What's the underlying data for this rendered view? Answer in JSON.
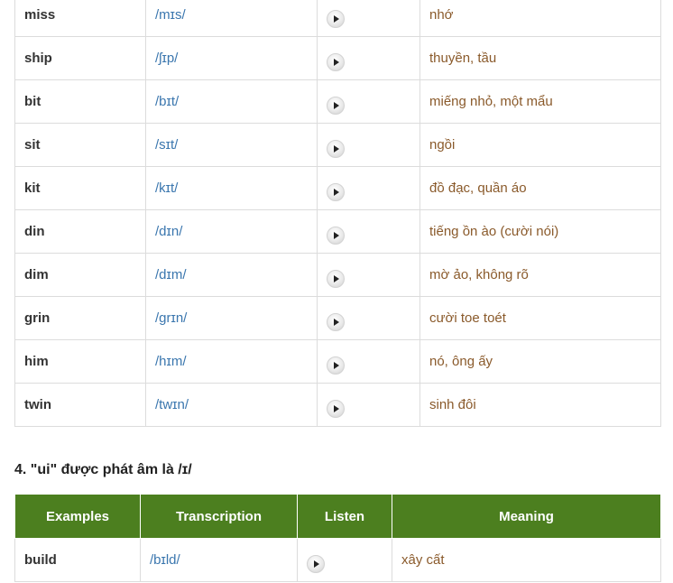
{
  "table1": {
    "rows": [
      {
        "word": "miss",
        "ipa": "/mɪs/",
        "meaning": "nhớ"
      },
      {
        "word": "ship",
        "ipa": "/ʃɪp/",
        "meaning": "thuyền, tầu"
      },
      {
        "word": "bit",
        "ipa": "/bɪt/",
        "meaning": "miếng nhỏ, một mẩu"
      },
      {
        "word": "sit",
        "ipa": "/sɪt/",
        "meaning": "ngồi"
      },
      {
        "word": "kit",
        "ipa": "/kɪt/",
        "meaning": "đồ đạc, quần áo"
      },
      {
        "word": "din",
        "ipa": "/dɪn/",
        "meaning": "tiếng ồn ào (cười nói)"
      },
      {
        "word": "dim",
        "ipa": "/dɪm/",
        "meaning": "mờ ảo, không rõ"
      },
      {
        "word": "grin",
        "ipa": "/grɪn/",
        "meaning": "cười toe toét"
      },
      {
        "word": "him",
        "ipa": "/hɪm/",
        "meaning": "nó, ông ấy"
      },
      {
        "word": "twin",
        "ipa": "/twɪn/",
        "meaning": "sinh đôi"
      }
    ]
  },
  "section4": {
    "heading": "4. \"ui\" được phát âm là /ɪ/",
    "headers": {
      "examples": "Examples",
      "transcription": "Transcription",
      "listen": "Listen",
      "meaning": "Meaning"
    },
    "rows": [
      {
        "word": "build",
        "ipa": "/bɪld/",
        "meaning": "xây cất"
      }
    ]
  },
  "colors": {
    "header_bg": "#4c7f1f",
    "transcription": "#3a76ae",
    "meaning": "#8a5a2b"
  },
  "icons": {
    "listen": "play-button-icon"
  }
}
